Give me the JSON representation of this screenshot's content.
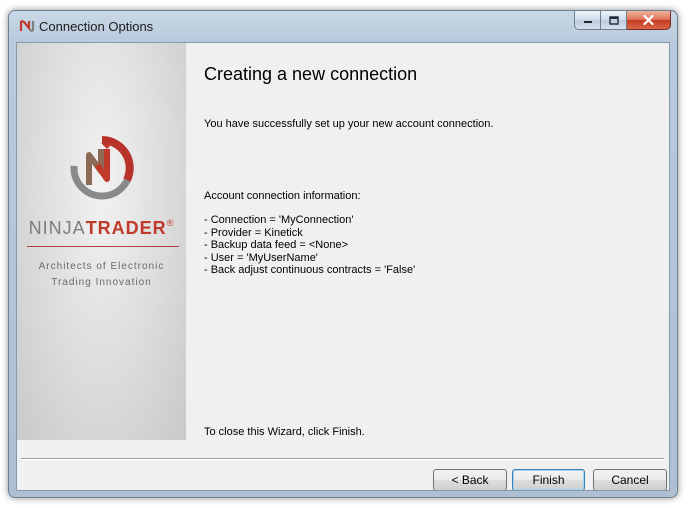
{
  "window": {
    "title": "Connection Options",
    "app_icon": "ninjatrader-logo-icon"
  },
  "caption_buttons": {
    "minimize_icon": "minimize-icon",
    "maximize_icon": "maximize-icon",
    "close_icon": "close-icon"
  },
  "side_panel": {
    "brand_first": "NINJA",
    "brand_second": "TRADER",
    "brand_mark": "®",
    "tagline_line1": "Architects of Electronic",
    "tagline_line2": "Trading Innovation"
  },
  "main": {
    "heading": "Creating a new connection",
    "success_message": "You have successfully set up your new account connection.",
    "info_heading": "Account connection information:",
    "info_items": [
      "- Connection = 'MyConnection'",
      "- Provider = Kinetick",
      "- Backup data feed = <None>",
      "- User = 'MyUserName'",
      "- Back adjust continuous contracts  = 'False'"
    ],
    "finish_hint": "To close this Wizard, click Finish."
  },
  "buttons": {
    "back": "< Back",
    "finish": "Finish",
    "cancel": "Cancel"
  },
  "colors": {
    "brand_red": "#c0392b",
    "brand_gray": "#7d7d7d",
    "close_button_red": "#c33b1c"
  }
}
